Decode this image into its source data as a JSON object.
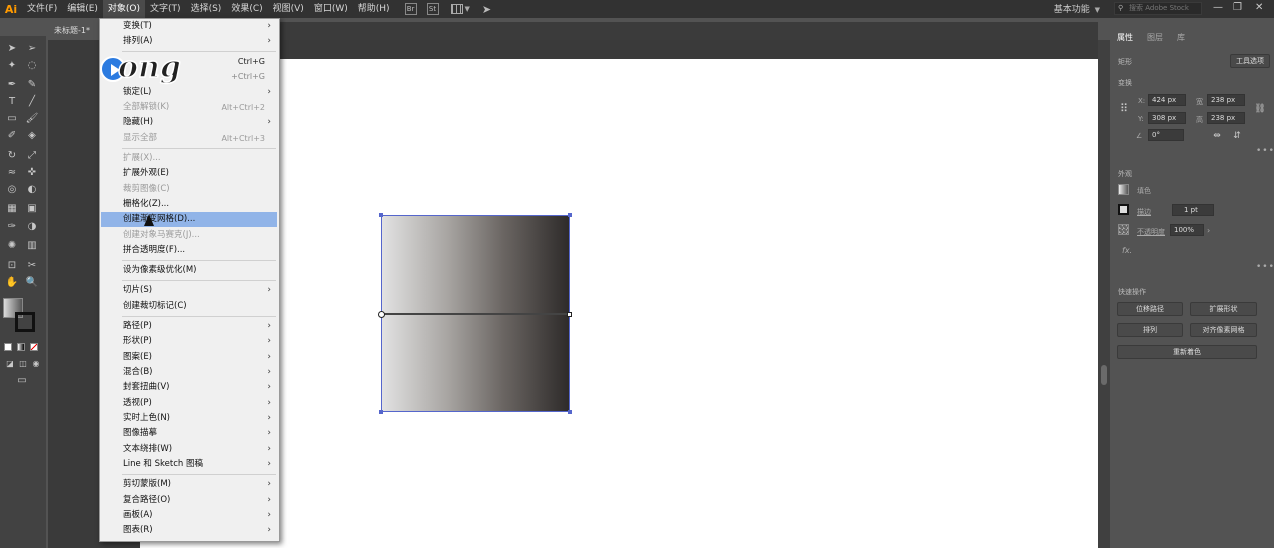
{
  "app": {
    "logo": "Ai"
  },
  "menubar": {
    "items": [
      "文件(F)",
      "编辑(E)",
      "对象(O)",
      "文字(T)",
      "选择(S)",
      "效果(C)",
      "视图(V)",
      "窗口(W)",
      "帮助(H)"
    ],
    "br": "Br",
    "st": "St",
    "workspace": "基本功能",
    "stock_placeholder": "搜索 Adobe Stock"
  },
  "document": {
    "tab": "未标题-1*"
  },
  "colors": {
    "accent": "#5566cc",
    "highlight": "#91b4e8",
    "logo": "#ff9a00"
  },
  "watermark": {
    "text": "ong"
  },
  "menu": {
    "items": [
      {
        "label": "变换(T)",
        "shortcut": "",
        "submenu": true,
        "disabled": false
      },
      {
        "label": "排列(A)",
        "shortcut": "",
        "submenu": true,
        "disabled": false
      },
      {
        "label": "",
        "shortcut": "Ctrl+G",
        "submenu": false,
        "disabled": false
      },
      {
        "label": "",
        "shortcut": "+Ctrl+G",
        "submenu": false,
        "disabled": false
      },
      {
        "label": "锁定(L)",
        "shortcut": "",
        "submenu": true,
        "disabled": false
      },
      {
        "label": "全部解锁(K)",
        "shortcut": "Alt+Ctrl+2",
        "submenu": false,
        "disabled": true
      },
      {
        "label": "隐藏(H)",
        "shortcut": "",
        "submenu": true,
        "disabled": false
      },
      {
        "label": "显示全部",
        "shortcut": "Alt+Ctrl+3",
        "submenu": false,
        "disabled": true
      },
      {
        "label": "扩展(X)...",
        "shortcut": "",
        "submenu": false,
        "disabled": true
      },
      {
        "label": "扩展外观(E)",
        "shortcut": "",
        "submenu": false,
        "disabled": false
      },
      {
        "label": "裁剪图像(C)",
        "shortcut": "",
        "submenu": false,
        "disabled": true
      },
      {
        "label": "栅格化(Z)...",
        "shortcut": "",
        "submenu": false,
        "disabled": false
      },
      {
        "label": "创建渐变网格(D)...",
        "shortcut": "",
        "submenu": false,
        "disabled": false,
        "highlighted": true
      },
      {
        "label": "创建对象马赛克(J)...",
        "shortcut": "",
        "submenu": false,
        "disabled": true
      },
      {
        "label": "拼合透明度(F)...",
        "shortcut": "",
        "submenu": false,
        "disabled": false
      },
      {
        "label": "设为像素级优化(M)",
        "shortcut": "",
        "submenu": false,
        "disabled": false
      },
      {
        "label": "切片(S)",
        "shortcut": "",
        "submenu": true,
        "disabled": false
      },
      {
        "label": "创建裁切标记(C)",
        "shortcut": "",
        "submenu": false,
        "disabled": false
      },
      {
        "label": "路径(P)",
        "shortcut": "",
        "submenu": true,
        "disabled": false
      },
      {
        "label": "形状(P)",
        "shortcut": "",
        "submenu": true,
        "disabled": false
      },
      {
        "label": "图案(E)",
        "shortcut": "",
        "submenu": true,
        "disabled": false
      },
      {
        "label": "混合(B)",
        "shortcut": "",
        "submenu": true,
        "disabled": false
      },
      {
        "label": "封套扭曲(V)",
        "shortcut": "",
        "submenu": true,
        "disabled": false
      },
      {
        "label": "透视(P)",
        "shortcut": "",
        "submenu": true,
        "disabled": false
      },
      {
        "label": "实时上色(N)",
        "shortcut": "",
        "submenu": true,
        "disabled": false
      },
      {
        "label": "图像描摹",
        "shortcut": "",
        "submenu": true,
        "disabled": false
      },
      {
        "label": "文本绕排(W)",
        "shortcut": "",
        "submenu": true,
        "disabled": false
      },
      {
        "label": "Line 和 Sketch 图稿",
        "shortcut": "",
        "submenu": true,
        "disabled": false
      },
      {
        "label": "剪切蒙版(M)",
        "shortcut": "",
        "submenu": true,
        "disabled": false
      },
      {
        "label": "复合路径(O)",
        "shortcut": "",
        "submenu": true,
        "disabled": false
      },
      {
        "label": "画板(A)",
        "shortcut": "",
        "submenu": true,
        "disabled": false
      },
      {
        "label": "图表(R)",
        "shortcut": "",
        "submenu": true,
        "disabled": false
      }
    ]
  },
  "panel": {
    "tabs": [
      "属性",
      "图层",
      "库"
    ],
    "shape_label": "矩形",
    "tool_options": "工具选项",
    "transform_title": "变换",
    "x_label": "X:",
    "x_value": "424 px",
    "y_label": "Y:",
    "y_value": "308 px",
    "w_label": "宽",
    "w_value": "238 px",
    "h_label": "高",
    "h_value": "238 px",
    "angle_value": "0°",
    "appearance_title": "外观",
    "fill_label": "填色",
    "stroke_label": "描边",
    "stroke_value": "1 pt",
    "opacity_label": "不透明度",
    "opacity_value": "100%",
    "fx": "fx.",
    "quick_actions_title": "快速操作",
    "btn_offset_path": "位移路径",
    "btn_expand_shape": "扩展形状",
    "btn_arrange": "排列",
    "btn_align_pixel": "对齐像素网格",
    "btn_recolor": "重新着色"
  }
}
